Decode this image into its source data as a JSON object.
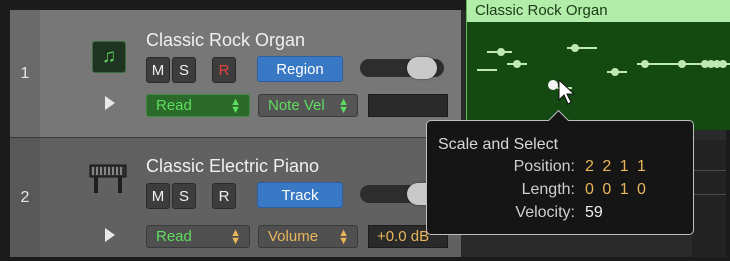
{
  "colors": {
    "accent_blue": "#3878c5",
    "read_green": "#5ede5e",
    "record_red": "#e0453d",
    "region_green": "#144a12",
    "region_header": "#b3edaa",
    "tooltip_value_orange": "#e9b65a"
  },
  "tracks": [
    {
      "number": "1",
      "name": "Classic Rock Organ",
      "mute": "M",
      "solo": "S",
      "record": "R",
      "mode_button": "Region",
      "automation_mode": "Read",
      "automation_param": "Note Vel",
      "value": "",
      "icon": "music-note-icon"
    },
    {
      "number": "2",
      "name": "Classic Electric Piano",
      "mute": "M",
      "solo": "S",
      "record": "R",
      "mode_button": "Track",
      "automation_mode": "Read",
      "automation_param": "Volume",
      "value": "+0.0 dB",
      "icon": "electric-piano-icon"
    }
  ],
  "region": {
    "title": "Classic Rock Organ"
  },
  "tooltip": {
    "title": "Scale and Select",
    "position_label": "Position:",
    "position_value": "2 2 1 1",
    "length_label": "Length:",
    "length_value": "0 0 1 0",
    "velocity_label": "Velocity:",
    "velocity_value": "59"
  }
}
